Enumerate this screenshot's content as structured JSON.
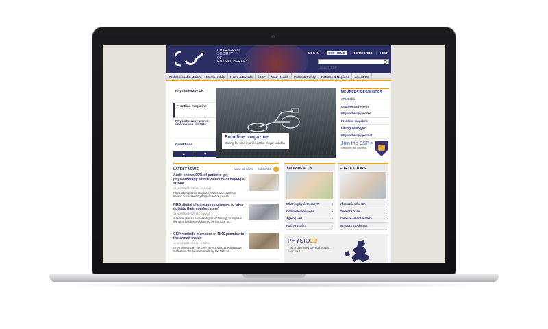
{
  "header": {
    "logo_lines": [
      "CHARTERED",
      "SOCIETY",
      "OF",
      "PHYSIOTHERAPY"
    ],
    "top_links": [
      "LOG IN",
      "CSP HOME",
      "NETWORKS",
      "HELP"
    ],
    "search_placeholder": "Search CSP"
  },
  "nav": [
    "Professional & Union",
    "Membership",
    "News & Events",
    "iCSP",
    "Your Health",
    "Press & Policy",
    "Nations & Regions",
    "About Us"
  ],
  "carousel": {
    "items": [
      "Physiotherapy UK",
      "Frontline magazine",
      "Physiotherapy works: information for GPs",
      "Conditions"
    ],
    "caption_title": "Frontline magazine",
    "caption_sub": "Caring for bike injuries at the Royal London"
  },
  "resources": {
    "title": "MEMBERS' RESOURCES",
    "items": [
      "ePortfolio",
      "Courses and events",
      "Physiotherapy works",
      "Frontline magazine",
      "Library catalogue",
      "Physiotherapy journal"
    ],
    "join_title": "Join the CSP >",
    "join_sub": "Discover the benefits"
  },
  "news": {
    "title": "LATEST NEWS",
    "view_all": "View all news",
    "subscribe": "Subscribe",
    "articles": [
      {
        "title": "Audit shows 99% of patients get physiotherapy within 24 hours of having a stroke",
        "date": "13 NOVEMBER 2014 - 10:51AM",
        "text": "Physiotherapists in England, Wales and Northern Ireland are assessing 99 per cent of patients..."
      },
      {
        "title": "NHS digital plan requires physios to 'step outside their comfort zone'",
        "date": "13 NOVEMBER 2014 - 8:56AM",
        "text": "A radical plan to harness digital technology to improve the NHS has been welcomed by the CSP as..."
      },
      {
        "title": "CSP reminds members of NHS promise to the armed forces",
        "date": "11 NOVEMBER 2014 - 3:37PM",
        "text": "On Armistice Day the CSP is reminding physiotherapy staff about the promise made by the NHS to..."
      }
    ]
  },
  "your_health": {
    "title": "YOUR HEALTH",
    "items": [
      "What is physiotherapy?",
      "Common conditions",
      "Ageing well",
      "Patient stories"
    ]
  },
  "for_doctors": {
    "title": "FOR DOCTORS",
    "items": [
      "Information for GPs",
      "Evidence base",
      "Exercise advice leaflets",
      "Common conditions"
    ]
  },
  "physio2u": {
    "title_a": "PHYSIO",
    "title_b": "2U",
    "text": "Find a chartered physiotherapist near you!"
  },
  "colors": {
    "brand": "#2b2e63",
    "accent": "#e8a62b"
  }
}
